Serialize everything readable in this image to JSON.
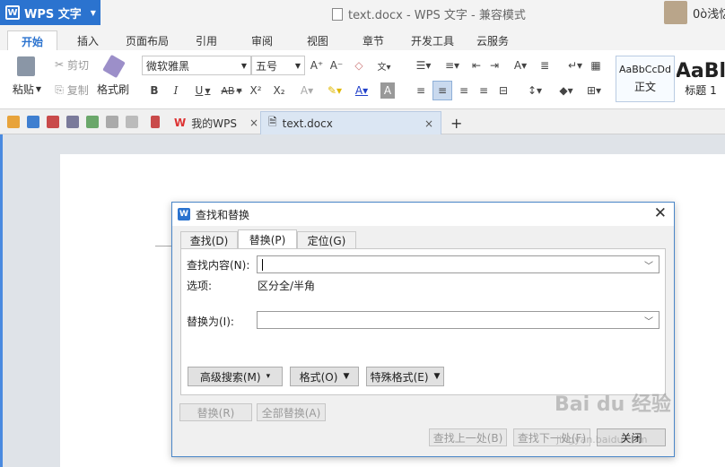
{
  "titlebar": {
    "app_name": "WPS 文字",
    "logo_letter": "W",
    "window_title": "text.docx - WPS 文字 - 兼容模式",
    "user_name": "0ò浅忆"
  },
  "ribbon_tabs": [
    "开始",
    "插入",
    "页面布局",
    "引用",
    "审阅",
    "视图",
    "章节",
    "开发工具",
    "云服务"
  ],
  "ribbon": {
    "paste": "粘贴",
    "cut": "剪切",
    "copy": "复制",
    "format_painter": "格式刷",
    "font_name": "微软雅黑",
    "font_size": "五号",
    "style_normal_sample": "AaBbCcDd",
    "style_normal_label": "正文",
    "style_heading_sample": "AaBl",
    "style_heading_label": "标题 1",
    "bold": "B",
    "italic": "I",
    "underline": "U",
    "strike": "AB",
    "superscript": "X²",
    "subscript": "X₂"
  },
  "doc_tabs": {
    "home_tab": "我的WPS",
    "file_tab": "text.docx",
    "close": "×",
    "new_tab": "+"
  },
  "dialog": {
    "title": "查找和替换",
    "logo_letter": "W",
    "close": "✕",
    "tabs": [
      "查找(D)",
      "替换(P)",
      "定位(G)"
    ],
    "find_label": "查找内容(N):",
    "find_value": "",
    "options_label": "选项:",
    "options_value": "区分全/半角",
    "replace_label": "替换为(I):",
    "replace_value": "",
    "advanced_search": "高级搜索(M)",
    "format": "格式(O)",
    "special_format": "特殊格式(E)",
    "replace_btn": "替换(R)",
    "replace_all_btn": "全部替换(A)",
    "find_prev_btn": "查找上一处(B)",
    "find_next_btn": "查找下一处(F)",
    "close_btn": "关闭"
  },
  "watermark": {
    "text": "Bai du 经验",
    "sub": "jingyan.baidu.com"
  },
  "colors": {
    "accent": "#2b73cf",
    "dialog_border": "#4a86c8"
  }
}
